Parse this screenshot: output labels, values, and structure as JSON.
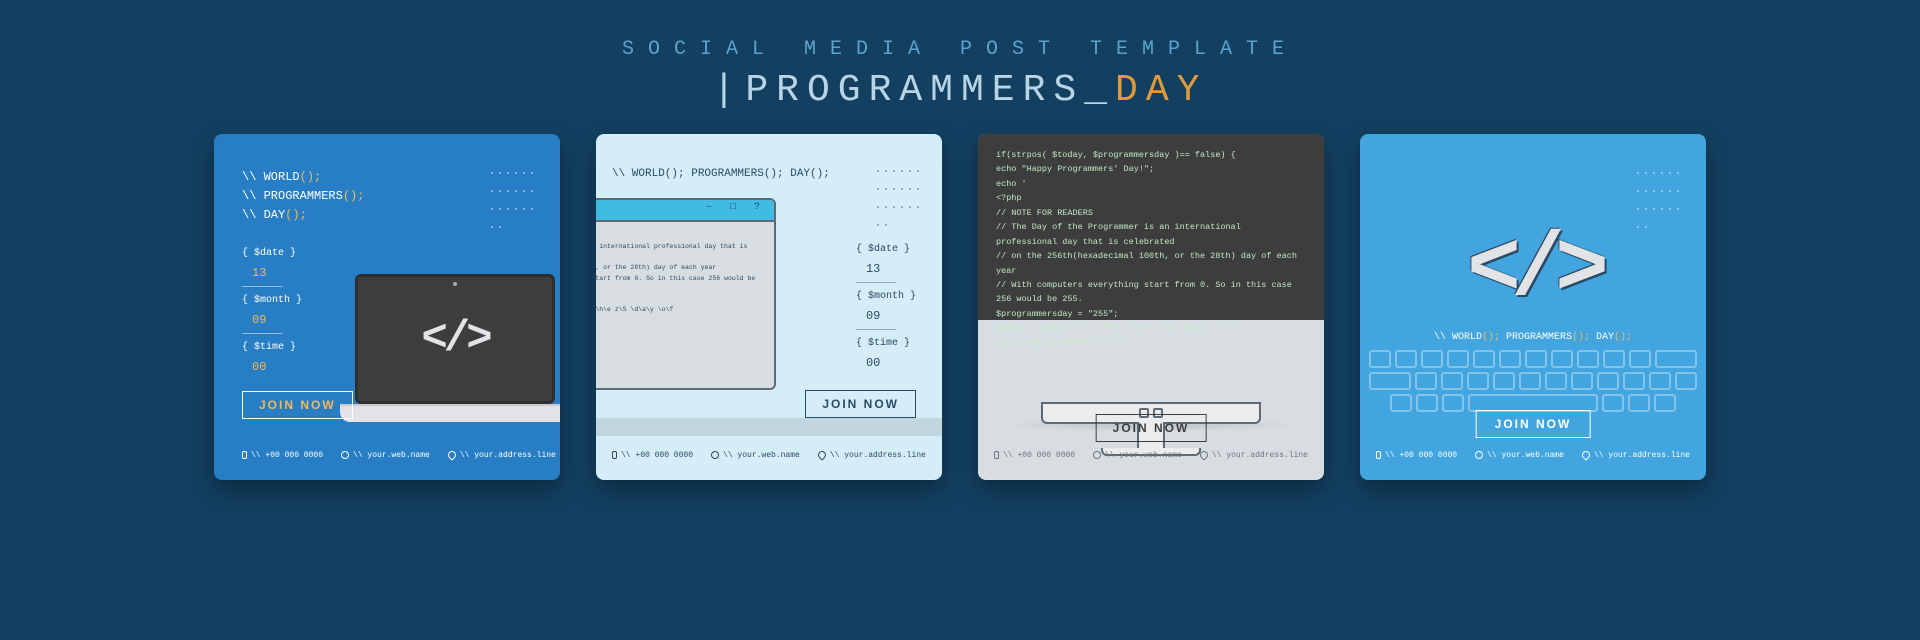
{
  "header": {
    "subtitle": "SOCIAL MEDIA POST TEMPLATE",
    "title_part1": "PROGRAMMERS",
    "title_underscore": "_",
    "title_part2": "DAY"
  },
  "common": {
    "join_label": "JOIN NOW",
    "contacts": {
      "phone": "\\\\ +00 000 0000",
      "web": "\\\\ your.web.name",
      "address": "\\\\ your.address.line"
    },
    "meta": {
      "date_label": "{ $date }",
      "date_value": "13",
      "month_label": "{ $month }",
      "month_value": "09",
      "time_label": "{ $time }",
      "time_value": "00"
    },
    "code_icon": "</>"
  },
  "card1": {
    "line1_a": "\\\\ ",
    "line1_b": "WORLD",
    "line1_c": "();",
    "line2_a": "\\\\ ",
    "line2_b": "PROGRAMMERS",
    "line2_c": "();",
    "line3_a": "\\\\ ",
    "line3_b": "DAY",
    "line3_c": "();"
  },
  "card2": {
    "headline": "\\\\ WORLD(); PROGRAMMERS(); DAY();",
    "window_text": "FOR READERS\nDay of the Programmer is an international professional day that is celebrated\nthe 256th(hexadecimal 100th, or the 28th) day of each year\nWith computers everything start from 0. So in this case 256 would be 255.\n$programmersday = \"255\";\n$today = date(\"\\f\\t \\f\\e \\t\\h\\e z\\S \\d\\a\\y \\o\\f \\p\\r\\o\\g\\r\\a\\m\\m\\e\\r\\s ?\");"
  },
  "card3": {
    "code": [
      "if(strpos( $today, $programmersday )== false) {",
      "echo \"Happy Programmers' Day!\";",
      "echo '",
      "  <?php",
      "  // NOTE FOR READERS",
      "  // The Day of the Programmer is an international professional day that is celebrated",
      "  // on the 256th(hexadecimal 100th, or the 28th) day of each year",
      "  // With computers everything start from 0. So in this case 256 would be 255.",
      "    $programmersday = \"255\";",
      "    $today = date(\"\\f\\t \\f\\e \\t\\h\\e z\\S \\d\\a\\y \\o\\f \\p\\r\\o\\g\\r\\a\\m\\m\\e\\r\\s ?\");"
    ]
  },
  "card4": {
    "headline_parts": [
      "\\\\ WORLD",
      "();",
      " PROGRAMMERS",
      "();",
      " DAY",
      "();"
    ]
  }
}
